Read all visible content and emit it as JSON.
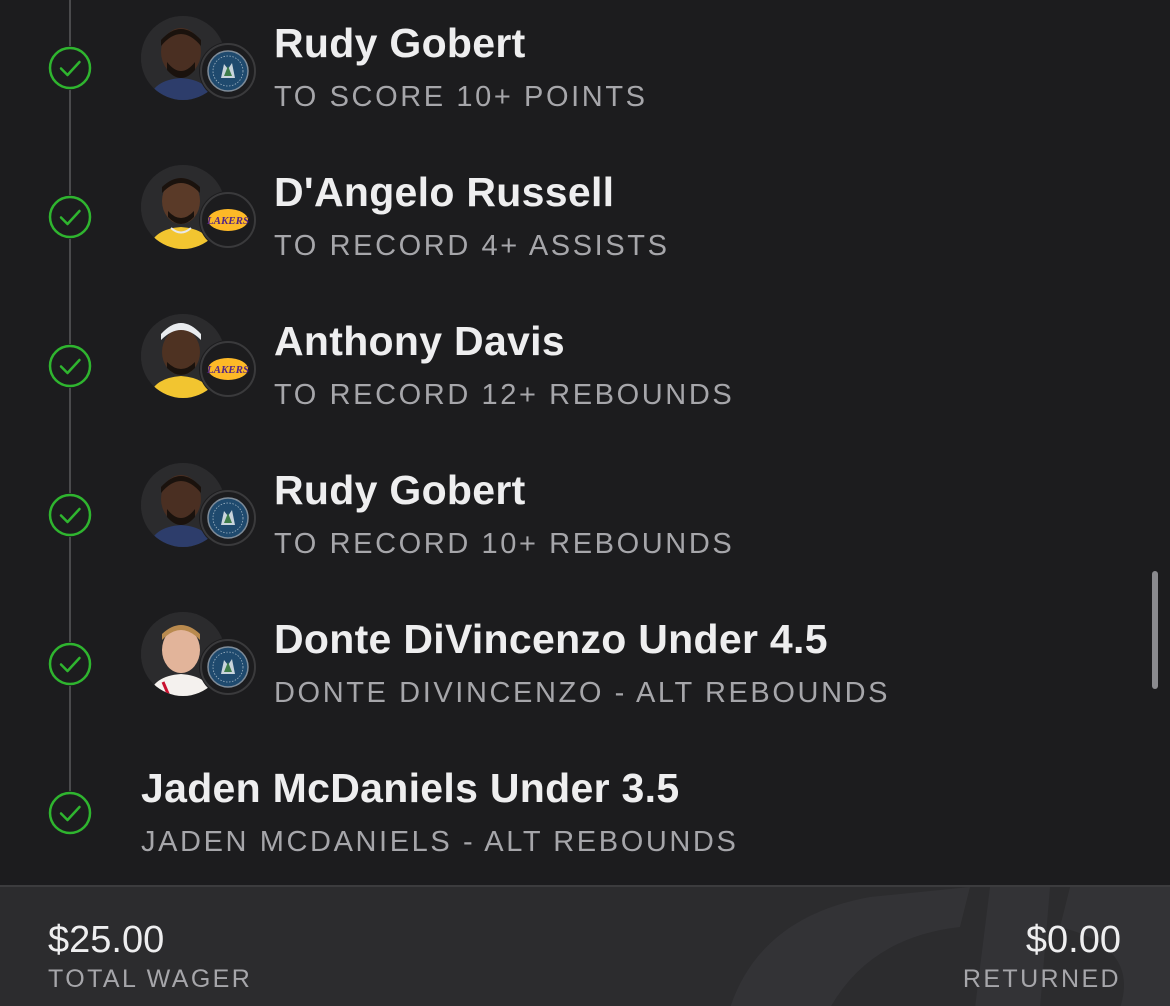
{
  "legs": [
    {
      "title": "Rudy Gobert",
      "subtitle": "TO SCORE 10+ POINTS",
      "status": "won",
      "team": "timberwolves"
    },
    {
      "title": "D'Angelo Russell",
      "subtitle": "TO RECORD 4+ ASSISTS",
      "status": "won",
      "team": "lakers",
      "team_logo_text": "LAKERS"
    },
    {
      "title": "Anthony Davis",
      "subtitle": "TO RECORD 12+ REBOUNDS",
      "status": "won",
      "team": "lakers",
      "team_logo_text": "LAKERS"
    },
    {
      "title": "Rudy Gobert",
      "subtitle": "TO RECORD 10+ REBOUNDS",
      "status": "won",
      "team": "timberwolves"
    },
    {
      "title": "Donte DiVincenzo Under 4.5",
      "subtitle": "DONTE DIVINCENZO - ALT REBOUNDS",
      "status": "won",
      "team": "timberwolves"
    },
    {
      "title": "Jaden McDaniels Under 3.5",
      "subtitle": "JADEN MCDANIELS - ALT REBOUNDS",
      "status": "won"
    }
  ],
  "footer": {
    "wager_amount": "$25.00",
    "wager_label": "TOTAL WAGER",
    "returned_amount": "$0.00",
    "returned_label": "RETURNED"
  },
  "colors": {
    "background": "#1c1c1e",
    "footer_background": "#2c2c2e",
    "check_green": "#2fb52f",
    "title_text": "#eeeeef",
    "subtitle_text": "#a6a6aa",
    "timberwolves_navy": "#1f4a6e",
    "lakers_purple": "#552583",
    "lakers_gold": "#fdb927"
  },
  "icons": {
    "status": "check-circle-icon",
    "timberwolves": "timberwolves-logo-icon",
    "lakers": "lakers-logo-icon"
  }
}
